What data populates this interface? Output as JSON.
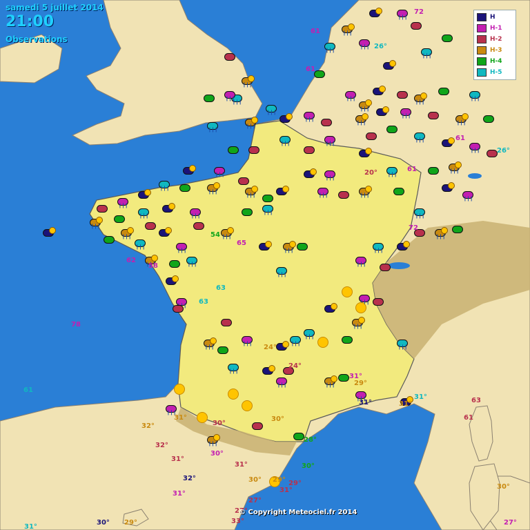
{
  "header": {
    "date": "samedi 5 juillet 2014",
    "time": "21:00",
    "subtitle": "Observations"
  },
  "legend": [
    {
      "label": "H",
      "color": "#1b1479"
    },
    {
      "label": "H-1",
      "color": "#c31fb1"
    },
    {
      "label": "H-2",
      "color": "#b8314d"
    },
    {
      "label": "H-3",
      "color": "#c98a10"
    },
    {
      "label": "H-4",
      "color": "#10a51a"
    },
    {
      "label": "H-5",
      "color": "#10b8c0"
    }
  ],
  "copyright": "© Copyright Meteociel.fr 2014",
  "temperatures": [
    "26°",
    "26°",
    "20°",
    "24°",
    "24°",
    "31°",
    "29°",
    "30°",
    "31°",
    "31°",
    "32°",
    "32°",
    "31°",
    "30°",
    "30°",
    "29°",
    "31°",
    "29°",
    "30°",
    "31°",
    "31°",
    "27°",
    "27°",
    "33°",
    "32°",
    "30°",
    "31°",
    "28°",
    "30°",
    "31°",
    "30°",
    "27°",
    "29°",
    "31°"
  ],
  "winds": [
    "72",
    "61",
    "61",
    "61",
    "61",
    "72",
    "54",
    "65",
    "63",
    "62",
    "78",
    "61",
    "63",
    "61",
    "63",
    "58"
  ],
  "colors": {
    "sea": "#2a7fd6",
    "land_france": "#f2ea7e",
    "land_other": "#f1e3b4",
    "alps": "#c9b172"
  }
}
